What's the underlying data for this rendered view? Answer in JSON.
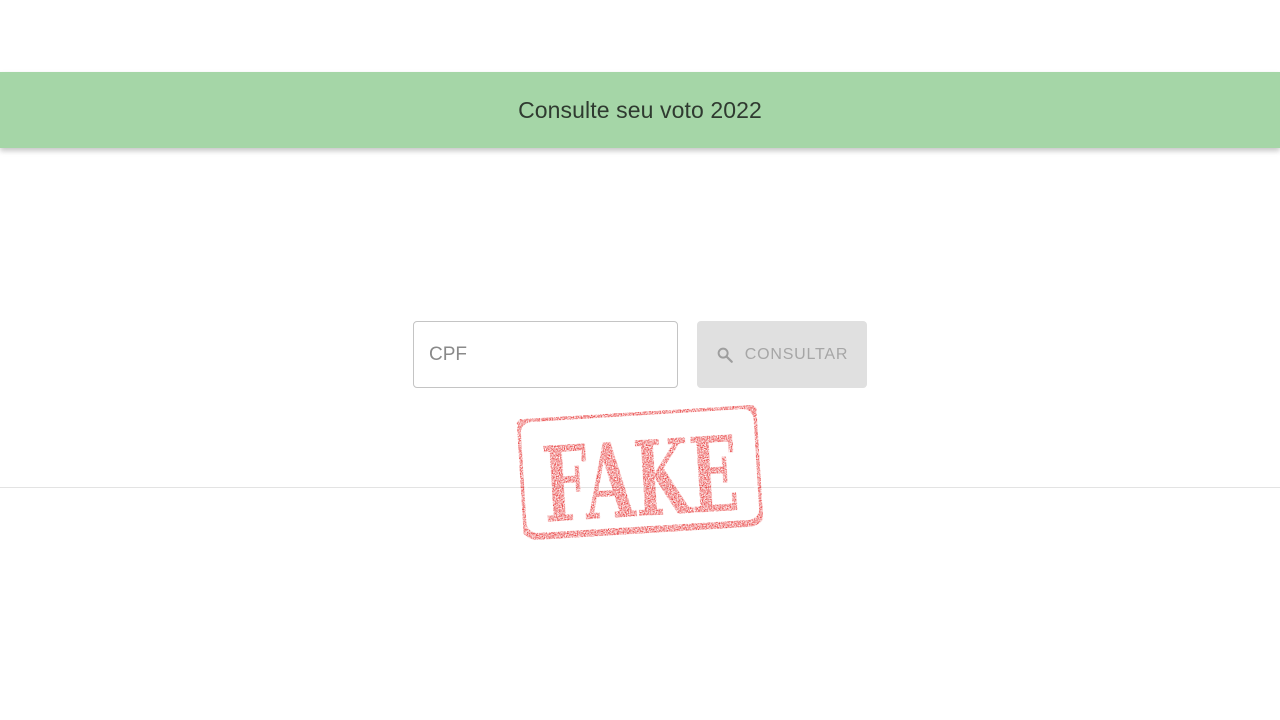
{
  "header": {
    "title": "Consulte seu voto 2022"
  },
  "form": {
    "cpf_placeholder": "CPF",
    "cpf_value": "",
    "consult_label": "CONSULTAR",
    "search_icon": "search-icon"
  },
  "stamp": {
    "text": "FAKE",
    "color": "#e10b0b"
  },
  "colors": {
    "header_bg": "#a5d6a7",
    "button_bg": "#e0e0e0",
    "stamp_red": "#e10b0b"
  }
}
